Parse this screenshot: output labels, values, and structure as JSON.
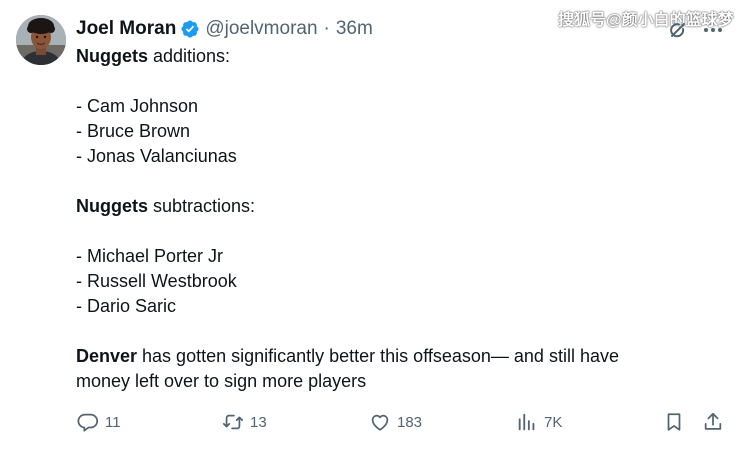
{
  "author": {
    "name": "Joel Moran",
    "handle": "@joelvmoran",
    "separator": "·",
    "time": "36m",
    "verified_color": "#1d9bf0"
  },
  "watermark": "搜狐号@颜小白的篮球梦",
  "body": {
    "lines": [
      {
        "bold": "Nuggets",
        "text": " additions:"
      },
      {
        "bold": "",
        "text": ""
      },
      {
        "bold": "",
        "text": "- Cam Johnson"
      },
      {
        "bold": "",
        "text": "- Bruce Brown"
      },
      {
        "bold": "",
        "text": "- Jonas Valanciunas"
      },
      {
        "bold": "",
        "text": ""
      },
      {
        "bold": "Nuggets",
        "text": " subtractions:"
      },
      {
        "bold": "",
        "text": ""
      },
      {
        "bold": "",
        "text": "- Michael Porter Jr"
      },
      {
        "bold": "",
        "text": "- Russell Westbrook"
      },
      {
        "bold": "",
        "text": "- Dario Saric"
      },
      {
        "bold": "",
        "text": ""
      },
      {
        "bold": "Denver",
        "text": " has gotten significantly better this offseason— and still have"
      },
      {
        "bold": "",
        "text": "money left over to sign more players"
      }
    ]
  },
  "actions": {
    "replies": "11",
    "reposts": "13",
    "likes": "183",
    "views": "7K"
  },
  "icons": {
    "reply": "reply-icon",
    "repost": "repost-icon",
    "like": "heart-icon",
    "views": "views-icon",
    "bookmark": "bookmark-icon",
    "share": "share-icon",
    "grok": "grok-icon",
    "more": "more-icon"
  },
  "colors": {
    "text": "#0f1419",
    "secondary": "#536471",
    "accent": "#1d9bf0",
    "background": "#ffffff"
  }
}
